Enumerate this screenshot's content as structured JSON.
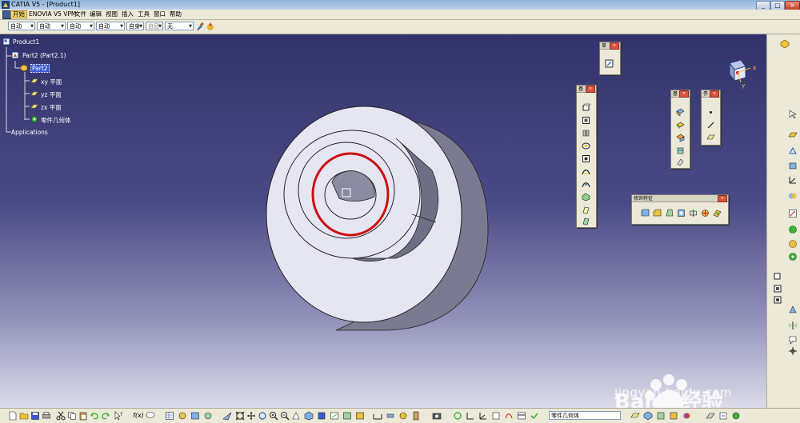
{
  "window": {
    "title": "CATIA V5 - [Product1]",
    "min_label": "_",
    "max_label": "□",
    "close_label": "×"
  },
  "menu": {
    "items": [
      "开始",
      "ENOVIA V5 VPM",
      "文件",
      "编辑",
      "视图",
      "插入",
      "工具",
      "窗口",
      "帮助"
    ]
  },
  "style_toolbar": {
    "combos": [
      "自动",
      "自动",
      "自动",
      "自动",
      "自身",
      "自动",
      "自目",
      "无"
    ]
  },
  "tree": {
    "root": "Product1",
    "part_instance": "Part2 (Part2.1)",
    "part": "Part2",
    "planes": [
      "xy 平面",
      "yz 平面",
      "zx 平面"
    ],
    "body": "零件几何体",
    "applications": "Applications"
  },
  "palettes": {
    "decoration": {
      "title": "修饰特征"
    },
    "small1": {
      "title": "草"
    },
    "vertical1": {
      "title": "基"
    },
    "vertical2": {
      "title": "基"
    },
    "vertical3": {
      "title": "参"
    }
  },
  "compass": {
    "x": "x",
    "y": "y",
    "z": "z"
  },
  "bottom_toolbar": {
    "fx_label": "f(x)",
    "command_input": "零件几何体"
  },
  "watermark": {
    "brand": "Baidu经验",
    "url": "jingyan.baidu.com"
  },
  "colors": {
    "viewport_top": "#33336b",
    "viewport_bottom": "#dcdcea",
    "part_face": "#e6e6f3",
    "part_side": "#7a7a90",
    "highlight_circle": "#cc1010",
    "tree_selected": "#3b59d4"
  }
}
